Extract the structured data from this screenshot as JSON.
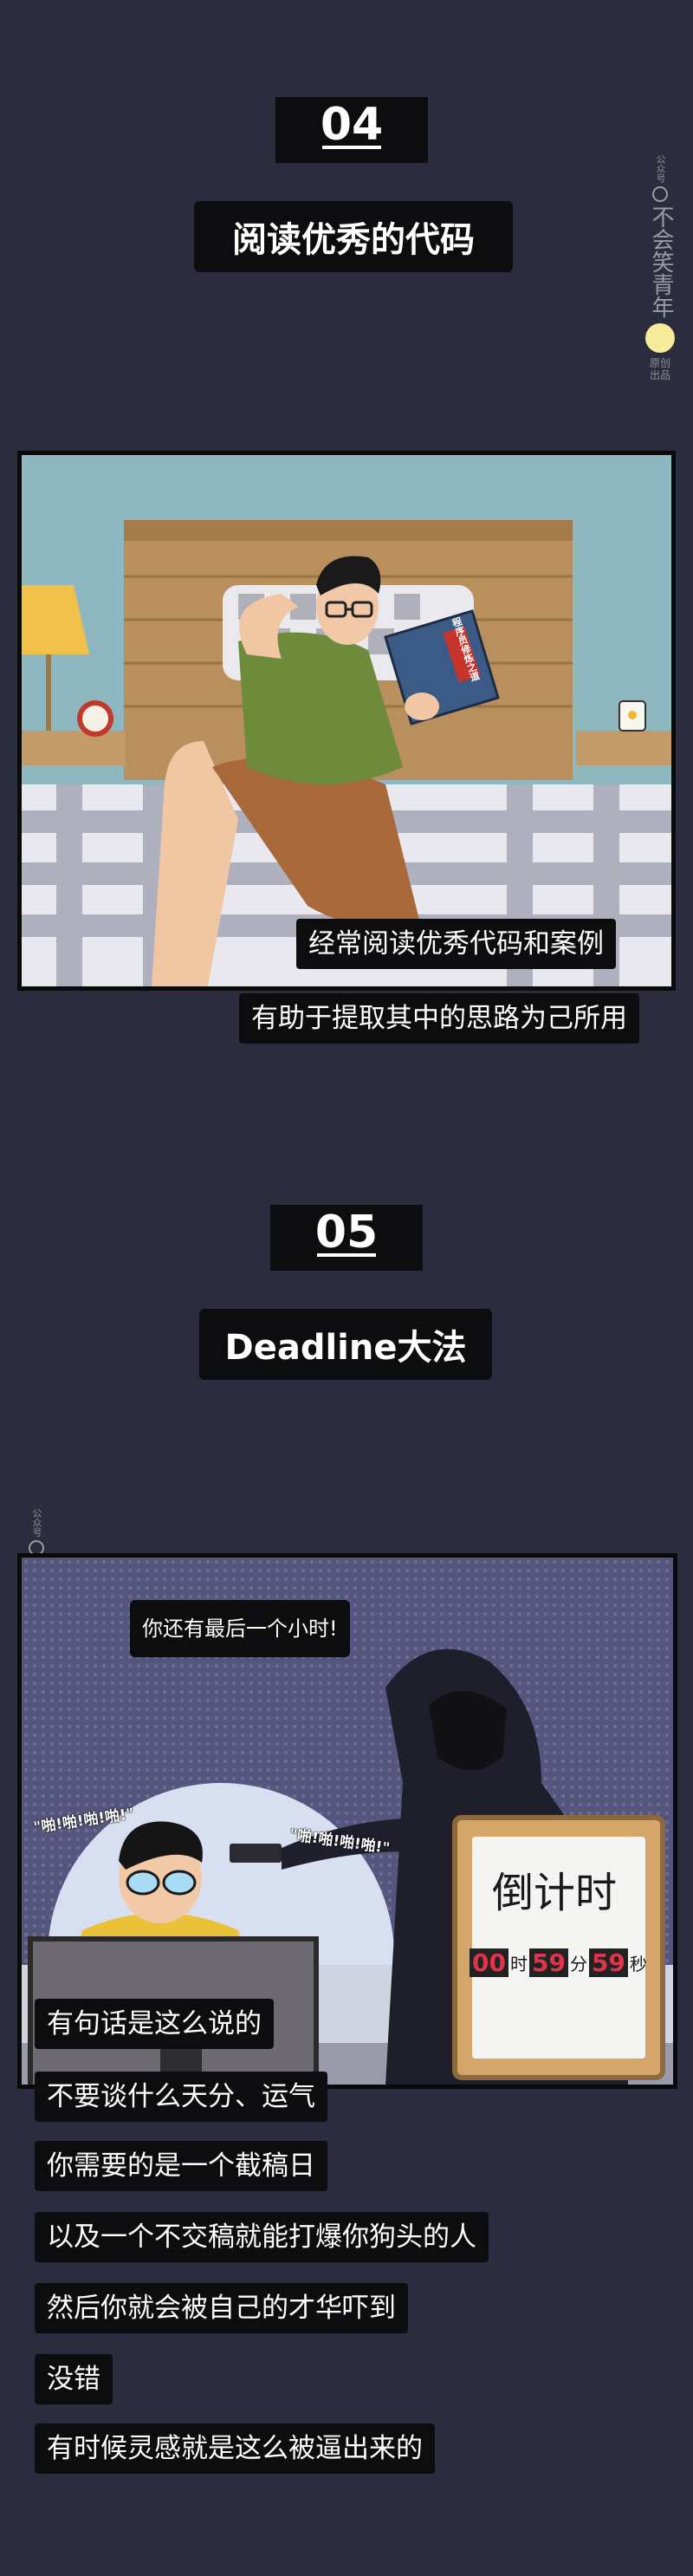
{
  "section4": {
    "number": "04",
    "title": "阅读优秀的代码",
    "captions": [
      "经常阅读优秀代码和案例",
      "有助于提取其中的思路为己所用"
    ]
  },
  "section5": {
    "number": "05",
    "title": "Deadline大法",
    "speech": "你还有最后一个小时!",
    "sfx_left": "\"啪!啪!啪!啪!\"",
    "sfx_right": "\"啪!啪!啪!啪!\"",
    "countdown": {
      "label": "倒计时",
      "hours": "00",
      "hours_unit": "时",
      "minutes": "59",
      "minutes_unit": "分",
      "seconds": "59",
      "seconds_unit": "秒"
    },
    "captions": [
      "有句话是这么说的",
      "不要谈什么天分、运气",
      "你需要的是一个截稿日",
      "以及一个不交稿就能打爆你狗头的人",
      "然后你就会被自己的才华吓到",
      "没错",
      "有时候灵感就是这么被逼出来的"
    ]
  },
  "watermark": {
    "account_label": "公众号",
    "name": "不会笑青年",
    "original_label": "原创出品"
  },
  "colors": {
    "background": "#2b2d3f",
    "badge": "#0d0d0f",
    "countdown_digits": "#e0344a"
  },
  "illustration_text": {
    "book_cover": "程序员修炼之道"
  }
}
